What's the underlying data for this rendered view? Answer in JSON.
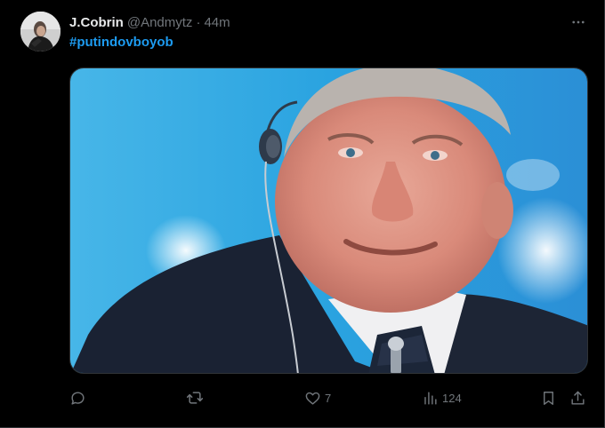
{
  "tweet": {
    "author_name": "J.Cobrin",
    "author_handle": "@Andmytz",
    "separator": "·",
    "timestamp": "44m",
    "hashtag": "#putindovboyob",
    "more_icon": "more-horizontal-icon",
    "media": {
      "description_icon": "photo"
    }
  },
  "actions": {
    "reply": {
      "icon": "reply-icon",
      "count": ""
    },
    "retweet": {
      "icon": "retweet-icon",
      "count": ""
    },
    "like": {
      "icon": "heart-icon",
      "count": "7"
    },
    "views": {
      "icon": "views-icon",
      "count": "124"
    },
    "bookmark": {
      "icon": "bookmark-icon"
    },
    "share": {
      "icon": "share-icon"
    }
  },
  "colors": {
    "background": "#000000",
    "text": "#e7e9ea",
    "muted": "#71767b",
    "link": "#1d9bf0"
  }
}
